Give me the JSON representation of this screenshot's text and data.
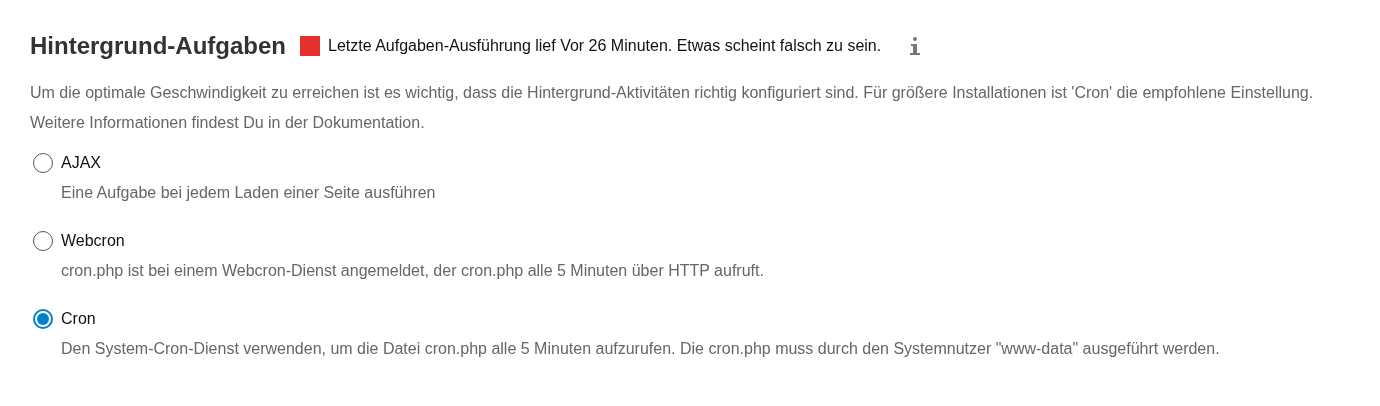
{
  "section": {
    "title": "Hintergrund-Aufgaben",
    "status": {
      "color": "#e53030",
      "text": "Letzte Aufgaben-Ausführung lief Vor 26 Minuten. Etwas scheint falsch zu sein."
    },
    "description": "Um die optimale Geschwindigkeit zu erreichen ist es wichtig, dass die Hintergrund-Aktivitäten richtig konfiguriert sind. Für größere Installationen ist 'Cron' die empfohlene Einstellung. Weitere Informationen findest Du in der Dokumentation."
  },
  "options": [
    {
      "label": "AJAX",
      "selected": false,
      "hint": "Eine Aufgabe bei jedem Laden einer Seite ausführen"
    },
    {
      "label": "Webcron",
      "selected": false,
      "hint": "cron.php ist bei einem Webcron-Dienst angemeldet, der cron.php alle 5 Minuten über HTTP aufruft."
    },
    {
      "label": "Cron",
      "selected": true,
      "hint": "Den System-Cron-Dienst verwenden, um die Datei cron.php alle 5 Minuten aufzurufen. Die cron.php muss durch den Systemnutzer \"www-data\" ausgeführt werden."
    }
  ]
}
